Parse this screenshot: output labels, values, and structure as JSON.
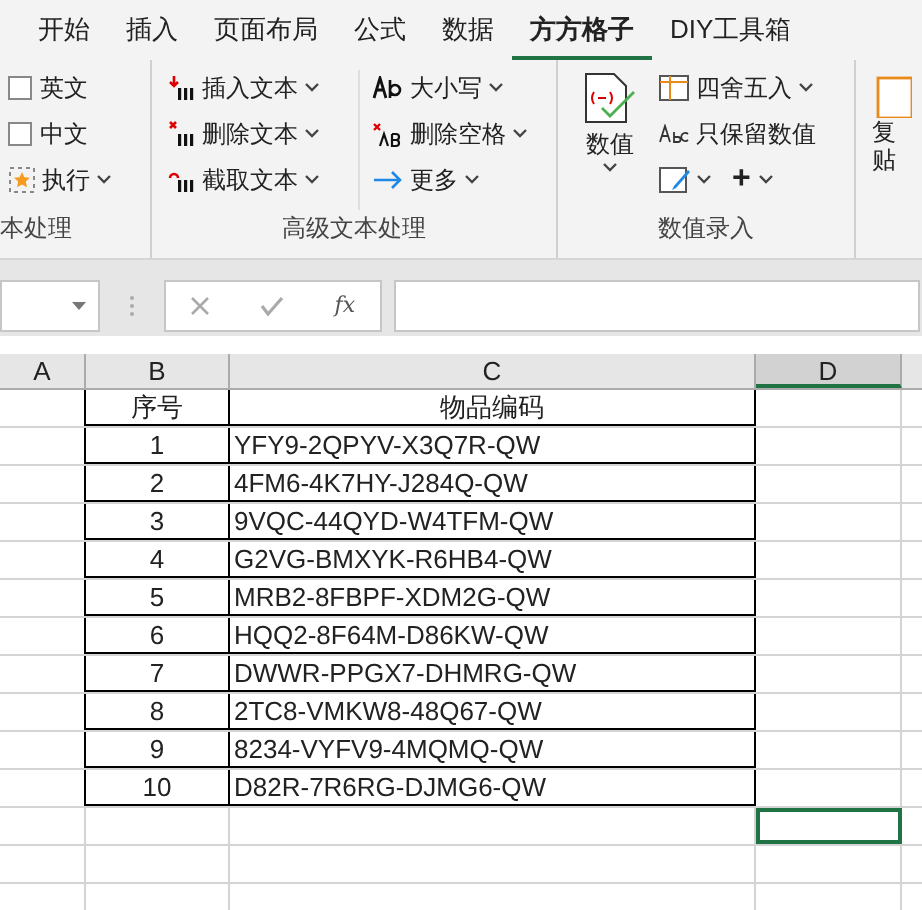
{
  "tabs": [
    {
      "label": "开始",
      "selected": false
    },
    {
      "label": "插入",
      "selected": false
    },
    {
      "label": "页面布局",
      "selected": false
    },
    {
      "label": "公式",
      "selected": false
    },
    {
      "label": "数据",
      "selected": false
    },
    {
      "label": "方方格子",
      "selected": true
    },
    {
      "label": "DIY工具箱",
      "selected": false
    }
  ],
  "ribbon": {
    "text_group": {
      "label": "本处理",
      "checkboxes": [
        {
          "label": "英文",
          "checked": false
        },
        {
          "label": "中文",
          "checked": false
        }
      ],
      "run_button": "执行"
    },
    "advanced_group": {
      "label": "高级文本处理",
      "left": [
        "插入文本",
        "删除文本",
        "截取文本"
      ],
      "right": [
        "大小写",
        "删除空格",
        "更多"
      ]
    },
    "number_group": {
      "label": "数值录入",
      "big_button": "数值",
      "round_button": "四舍五入",
      "keep_button": "只保留数值",
      "plus": "+"
    },
    "cut_group": {
      "lines": [
        "复",
        "贴"
      ]
    }
  },
  "formula_bar": {
    "fx": "fx"
  },
  "columns": [
    {
      "label": "A",
      "selected": false
    },
    {
      "label": "B",
      "selected": false
    },
    {
      "label": "C",
      "selected": false
    },
    {
      "label": "D",
      "selected": true
    }
  ],
  "table": {
    "header": [
      "序号",
      "物品编码"
    ],
    "rows": [
      [
        "1",
        "YFY9-2QPYV-X3Q7R-QW"
      ],
      [
        "2",
        "4FM6-4K7HY-J284Q-QW"
      ],
      [
        "3",
        "9VQC-44QYD-W4TFM-QW"
      ],
      [
        "4",
        "G2VG-BMXYK-R6HB4-QW"
      ],
      [
        "5",
        "MRB2-8FBPF-XDM2G-QW"
      ],
      [
        "6",
        "HQQ2-8F64M-D86KW-QW"
      ],
      [
        "7",
        "DWWR-PPGX7-DHMRG-QW"
      ],
      [
        "8",
        "2TC8-VMKW8-48Q67-QW"
      ],
      [
        "9",
        "8234-VYFV9-4MQMQ-QW"
      ],
      [
        "10",
        "D82R-7R6RG-DJMG6-QW"
      ]
    ]
  },
  "extra_rows": [
    {
      "selected": true
    },
    {
      "selected": false
    },
    {
      "selected": false
    }
  ]
}
